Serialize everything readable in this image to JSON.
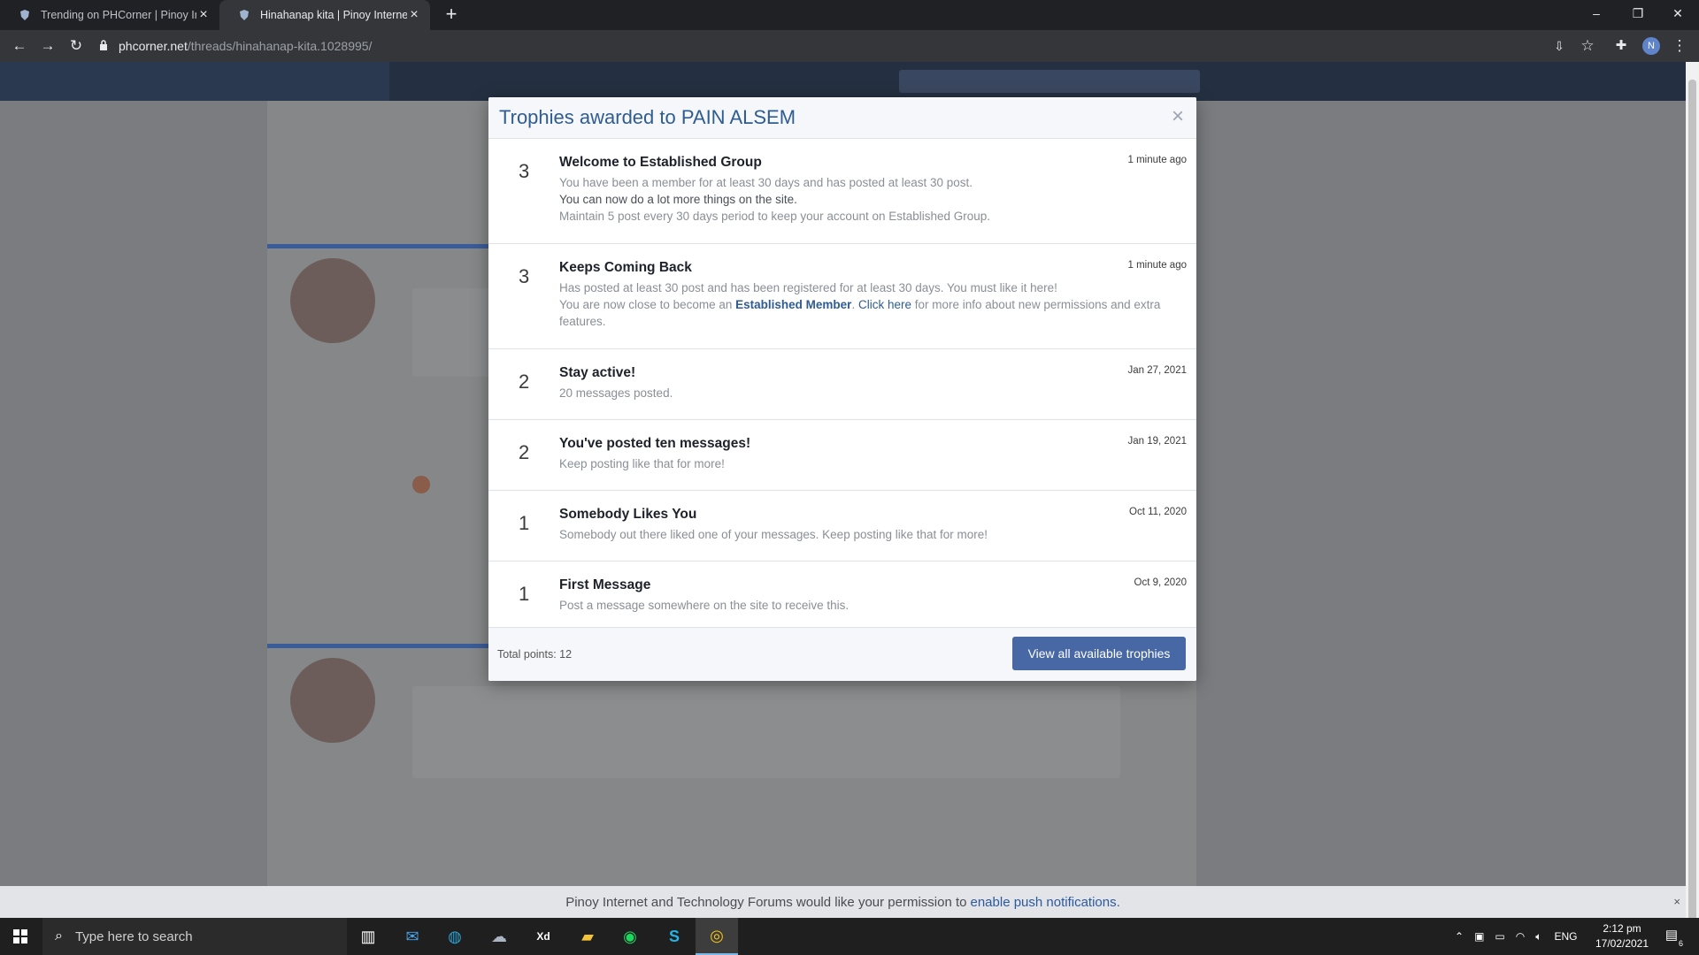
{
  "browser": {
    "tabs": [
      {
        "title": "Trending on PHCorner | Pinoy Int",
        "active": false
      },
      {
        "title": "Hinahanap kita | Pinoy Internet a",
        "active": true
      }
    ],
    "new_tab": "+",
    "url_domain": "phcorner.net",
    "url_path": "/threads/hinahanap-kita.1028995/",
    "profile_initial": "N"
  },
  "modal": {
    "title": "Trophies awarded to PAIN ALSEM",
    "close": "×",
    "trophies": [
      {
        "points": "3",
        "name": "Welcome to Established Group",
        "time": "1 minute ago",
        "lines": [
          "You have been a member for at least 30 days and has posted at least 30 post.",
          "You can now do a lot more things on the site.",
          "Maintain 5 post every 30 days period to keep your account on Established Group."
        ]
      },
      {
        "points": "3",
        "name": "Keeps Coming Back",
        "time": "1 minute ago",
        "line1": "Has posted at least 30 post and has been registered for at least 30 days. You must like it here!",
        "line2_a": "You are now close to become an ",
        "line2_strong": "Established Member",
        "line2_b": ". ",
        "line2_link": "Click here",
        "line2_c": " for more info about new permissions and extra features."
      },
      {
        "points": "2",
        "name": "Stay active!",
        "time": "Jan 27, 2021",
        "desc": "20 messages posted."
      },
      {
        "points": "2",
        "name": "You've posted ten messages!",
        "time": "Jan 19, 2021",
        "desc": "Keep posting like that for more!"
      },
      {
        "points": "1",
        "name": "Somebody Likes You",
        "time": "Oct 11, 2020",
        "desc": "Somebody out there liked one of your messages. Keep posting like that for more!"
      },
      {
        "points": "1",
        "name": "First Message",
        "time": "Oct 9, 2020",
        "desc": "Post a message somewhere on the site to receive this."
      }
    ],
    "total": "Total points: 12",
    "view_all": "View all available trophies"
  },
  "push_notice": {
    "text": "Pinoy Internet and Technology Forums would like your permission to",
    "link": "enable push notifications."
  },
  "taskbar": {
    "search_placeholder": "Type here to search",
    "lang": "ENG",
    "time": "2:12 pm",
    "date": "17/02/2021",
    "notif_count": "6"
  }
}
